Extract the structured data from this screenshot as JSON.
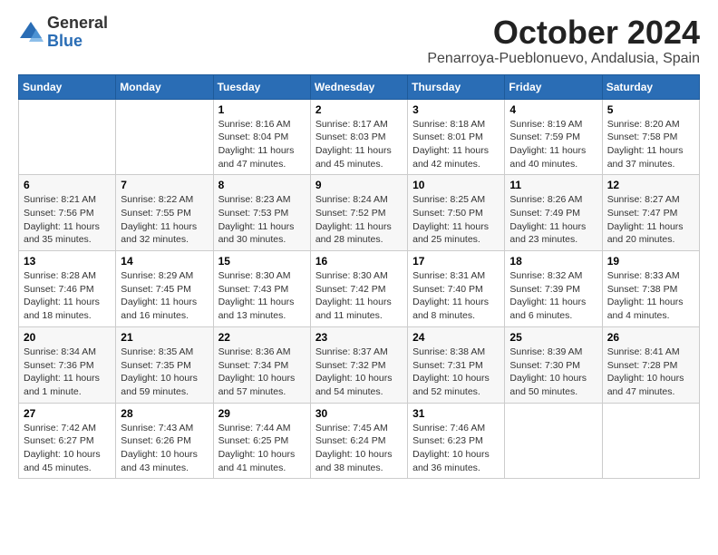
{
  "logo": {
    "general": "General",
    "blue": "Blue"
  },
  "title": "October 2024",
  "subtitle": "Penarroya-Pueblonuevo, Andalusia, Spain",
  "days_of_week": [
    "Sunday",
    "Monday",
    "Tuesday",
    "Wednesday",
    "Thursday",
    "Friday",
    "Saturday"
  ],
  "weeks": [
    [
      {
        "day": "",
        "info": ""
      },
      {
        "day": "",
        "info": ""
      },
      {
        "day": "1",
        "info": "Sunrise: 8:16 AM\nSunset: 8:04 PM\nDaylight: 11 hours and 47 minutes."
      },
      {
        "day": "2",
        "info": "Sunrise: 8:17 AM\nSunset: 8:03 PM\nDaylight: 11 hours and 45 minutes."
      },
      {
        "day": "3",
        "info": "Sunrise: 8:18 AM\nSunset: 8:01 PM\nDaylight: 11 hours and 42 minutes."
      },
      {
        "day": "4",
        "info": "Sunrise: 8:19 AM\nSunset: 7:59 PM\nDaylight: 11 hours and 40 minutes."
      },
      {
        "day": "5",
        "info": "Sunrise: 8:20 AM\nSunset: 7:58 PM\nDaylight: 11 hours and 37 minutes."
      }
    ],
    [
      {
        "day": "6",
        "info": "Sunrise: 8:21 AM\nSunset: 7:56 PM\nDaylight: 11 hours and 35 minutes."
      },
      {
        "day": "7",
        "info": "Sunrise: 8:22 AM\nSunset: 7:55 PM\nDaylight: 11 hours and 32 minutes."
      },
      {
        "day": "8",
        "info": "Sunrise: 8:23 AM\nSunset: 7:53 PM\nDaylight: 11 hours and 30 minutes."
      },
      {
        "day": "9",
        "info": "Sunrise: 8:24 AM\nSunset: 7:52 PM\nDaylight: 11 hours and 28 minutes."
      },
      {
        "day": "10",
        "info": "Sunrise: 8:25 AM\nSunset: 7:50 PM\nDaylight: 11 hours and 25 minutes."
      },
      {
        "day": "11",
        "info": "Sunrise: 8:26 AM\nSunset: 7:49 PM\nDaylight: 11 hours and 23 minutes."
      },
      {
        "day": "12",
        "info": "Sunrise: 8:27 AM\nSunset: 7:47 PM\nDaylight: 11 hours and 20 minutes."
      }
    ],
    [
      {
        "day": "13",
        "info": "Sunrise: 8:28 AM\nSunset: 7:46 PM\nDaylight: 11 hours and 18 minutes."
      },
      {
        "day": "14",
        "info": "Sunrise: 8:29 AM\nSunset: 7:45 PM\nDaylight: 11 hours and 16 minutes."
      },
      {
        "day": "15",
        "info": "Sunrise: 8:30 AM\nSunset: 7:43 PM\nDaylight: 11 hours and 13 minutes."
      },
      {
        "day": "16",
        "info": "Sunrise: 8:30 AM\nSunset: 7:42 PM\nDaylight: 11 hours and 11 minutes."
      },
      {
        "day": "17",
        "info": "Sunrise: 8:31 AM\nSunset: 7:40 PM\nDaylight: 11 hours and 8 minutes."
      },
      {
        "day": "18",
        "info": "Sunrise: 8:32 AM\nSunset: 7:39 PM\nDaylight: 11 hours and 6 minutes."
      },
      {
        "day": "19",
        "info": "Sunrise: 8:33 AM\nSunset: 7:38 PM\nDaylight: 11 hours and 4 minutes."
      }
    ],
    [
      {
        "day": "20",
        "info": "Sunrise: 8:34 AM\nSunset: 7:36 PM\nDaylight: 11 hours and 1 minute."
      },
      {
        "day": "21",
        "info": "Sunrise: 8:35 AM\nSunset: 7:35 PM\nDaylight: 10 hours and 59 minutes."
      },
      {
        "day": "22",
        "info": "Sunrise: 8:36 AM\nSunset: 7:34 PM\nDaylight: 10 hours and 57 minutes."
      },
      {
        "day": "23",
        "info": "Sunrise: 8:37 AM\nSunset: 7:32 PM\nDaylight: 10 hours and 54 minutes."
      },
      {
        "day": "24",
        "info": "Sunrise: 8:38 AM\nSunset: 7:31 PM\nDaylight: 10 hours and 52 minutes."
      },
      {
        "day": "25",
        "info": "Sunrise: 8:39 AM\nSunset: 7:30 PM\nDaylight: 10 hours and 50 minutes."
      },
      {
        "day": "26",
        "info": "Sunrise: 8:41 AM\nSunset: 7:28 PM\nDaylight: 10 hours and 47 minutes."
      }
    ],
    [
      {
        "day": "27",
        "info": "Sunrise: 7:42 AM\nSunset: 6:27 PM\nDaylight: 10 hours and 45 minutes."
      },
      {
        "day": "28",
        "info": "Sunrise: 7:43 AM\nSunset: 6:26 PM\nDaylight: 10 hours and 43 minutes."
      },
      {
        "day": "29",
        "info": "Sunrise: 7:44 AM\nSunset: 6:25 PM\nDaylight: 10 hours and 41 minutes."
      },
      {
        "day": "30",
        "info": "Sunrise: 7:45 AM\nSunset: 6:24 PM\nDaylight: 10 hours and 38 minutes."
      },
      {
        "day": "31",
        "info": "Sunrise: 7:46 AM\nSunset: 6:23 PM\nDaylight: 10 hours and 36 minutes."
      },
      {
        "day": "",
        "info": ""
      },
      {
        "day": "",
        "info": ""
      }
    ]
  ]
}
